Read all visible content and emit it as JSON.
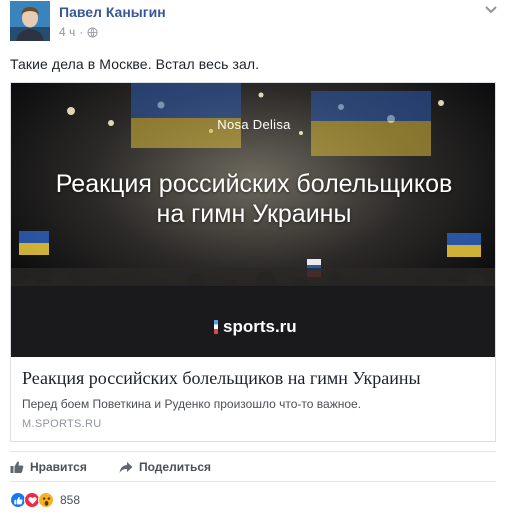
{
  "post": {
    "author": "Павел Каныгин",
    "time": "4 ч",
    "separator": "·",
    "privacy_icon": "globe-icon",
    "menu_icon": "chevron-down-icon",
    "text": "Такие дела в Москве. Встал весь зал."
  },
  "link_card": {
    "image": {
      "author_overlay": "Nosa Delisa",
      "title_line1": "Реакция российских болельщиков",
      "title_line2": "на гимн Украины",
      "logo_text": "sports.ru"
    },
    "title": "Реакция российских болельщиков на гимн Украины",
    "description": "Перед боем Поветкина и Руденко произошло что-то важное.",
    "domain": "M.SPORTS.RU"
  },
  "actions": {
    "like_label": "Нравится",
    "share_label": "Поделиться"
  },
  "reactions": {
    "types": [
      "like",
      "love",
      "wow"
    ],
    "count": "858"
  },
  "colors": {
    "link_blue": "#365899",
    "like_blue": "#1877f2",
    "love_red": "#f0284a",
    "wow_yellow": "#f7b125",
    "muted_gray": "#90949c"
  }
}
